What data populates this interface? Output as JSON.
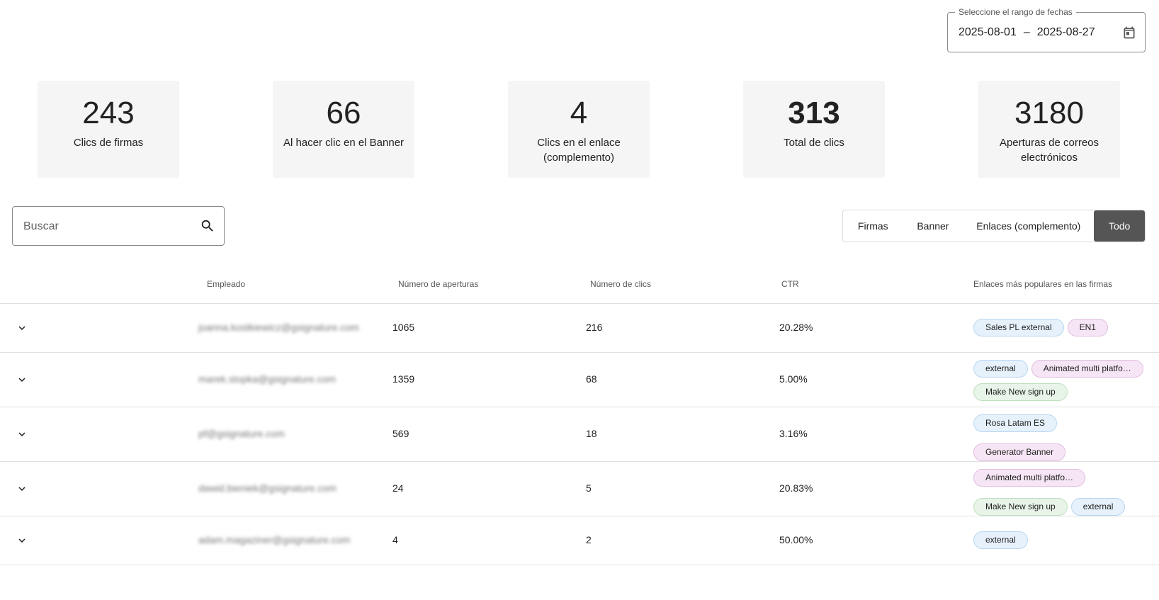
{
  "date_range": {
    "legend": "Seleccione el rango de fechas",
    "start": "2025-08-01",
    "separator": "–",
    "end": "2025-08-27",
    "icon": "calendar-icon"
  },
  "stats": [
    {
      "value": "243",
      "label": "Clics de firmas"
    },
    {
      "value": "66",
      "label": "Al hacer clic en el Banner"
    },
    {
      "value": "4",
      "label": "Clics en el enlace (complemento)"
    },
    {
      "value": "313",
      "label": "Total de clics"
    },
    {
      "value": "3180",
      "label": "Aperturas de correos electrónicos"
    }
  ],
  "search": {
    "placeholder": "Buscar",
    "icon": "search-icon"
  },
  "filters": {
    "firmas": "Firmas",
    "banner": "Banner",
    "enlaces": "Enlaces (complemento)",
    "todo": "Todo",
    "active": "todo"
  },
  "table": {
    "headers": {
      "empleado": "Empleado",
      "aperturas": "Número de aperturas",
      "clics": "Número de clics",
      "ctr": "CTR",
      "enlaces": "Enlaces más populares en las firmas"
    },
    "rows": [
      {
        "email": "joanna.kostkiewicz@gsignature.com",
        "aperturas": "1065",
        "clics": "216",
        "ctr": "20.28%",
        "links": [
          {
            "label": "Sales PL external",
            "color": "blue"
          },
          {
            "label": "EN1",
            "color": "pink"
          }
        ]
      },
      {
        "email": "marek.stopka@gsignature.com",
        "aperturas": "1359",
        "clics": "68",
        "ctr": "5.00%",
        "links": [
          {
            "label": "external",
            "color": "blue"
          },
          {
            "label": "Animated multi platfo…",
            "color": "pink"
          },
          {
            "label": "Make New sign up",
            "color": "green"
          }
        ]
      },
      {
        "email": "pf@gsignature.com",
        "aperturas": "569",
        "clics": "18",
        "ctr": "3.16%",
        "links": [
          {
            "label": "Rosa Latam ES",
            "color": "blue"
          },
          {
            "label": "Generator Banner",
            "color": "pink"
          }
        ]
      },
      {
        "email": "dawid.bieniek@gsignature.com",
        "aperturas": "24",
        "clics": "5",
        "ctr": "20.83%",
        "links": [
          {
            "label": "Animated multi platfo…",
            "color": "pink"
          },
          {
            "label": "Make New sign up",
            "color": "green"
          },
          {
            "label": "external",
            "color": "blue"
          }
        ]
      },
      {
        "email": "adam.magaziner@gsignature.com",
        "aperturas": "4",
        "clics": "2",
        "ctr": "50.00%",
        "links": [
          {
            "label": "external",
            "color": "blue"
          }
        ]
      }
    ]
  },
  "colors": {
    "chip_blue": "#e6f1fb",
    "chip_pink": "#f6e6f5",
    "chip_green": "#e8f4e8",
    "active_tab": "#555555",
    "card_bg": "#f5f5f5"
  }
}
